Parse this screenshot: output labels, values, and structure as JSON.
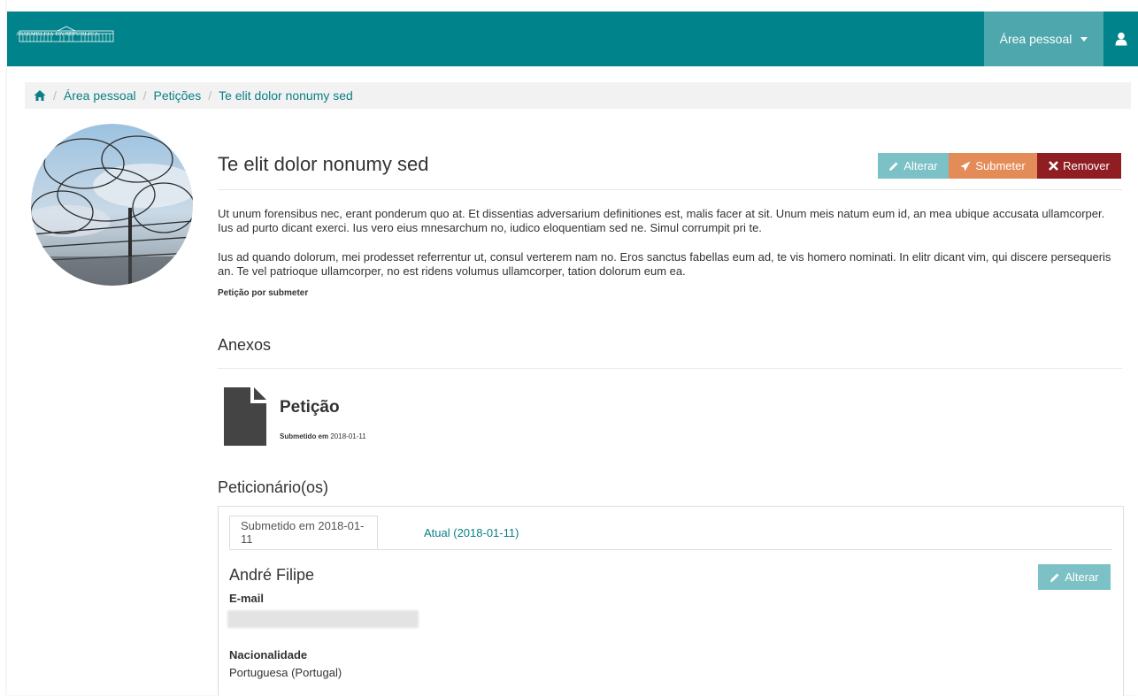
{
  "header": {
    "logo_text": "ASSEMBLEIA DA REPÚBLICA",
    "user_menu_label": "Área pessoal"
  },
  "breadcrumb": {
    "items": [
      "Área pessoal",
      "Petições",
      "Te elit dolor nonumy sed"
    ]
  },
  "petition": {
    "title": "Te elit dolor nonumy sed",
    "actions": {
      "edit_label": "Alterar",
      "submit_label": "Submeter",
      "remove_label": "Remover"
    },
    "paragraph_1": "Ut unum forensibus nec, erant ponderum quo at. Et dissentias adversarium definitiones est, malis facer at sit. Unum meis natum eum id, an mea ubique accusata ullamcorper. Ius ad purto dicant exerci. Ius vero eius mnesarchum no, iudico eloquentiam sed ne. Simul corrumpit pri te.",
    "paragraph_2": "Ius ad quando dolorum, mei prodesset referrentur ut, consul verterem nam no. Eros sanctus fabellas eum ad, te vis homero nominati. In elitr dicant vim, qui discere persequeris an. Te vel patrioque ullamcorper, no est ridens volumus ullamcorper, tation dolorum eum ea.",
    "status": "Petição por submeter"
  },
  "attachments": {
    "heading": "Anexos",
    "file_title": "Petição",
    "submitted_label": "Submetido em",
    "submitted_date": "2018-01-11"
  },
  "petitioners": {
    "heading": "Peticionário(os)",
    "tabs": [
      "Submetido em 2018-01-11",
      "Atual (2018-01-11)"
    ],
    "name": "André Filipe",
    "edit_label": "Alterar",
    "email_label": "E-mail",
    "nationality_label": "Nacionalidade",
    "nationality_value": "Portuguesa (Portugal)"
  },
  "colors": {
    "brand": "#00838a",
    "edit": "#7cc1c5",
    "submit": "#e48c58",
    "remove": "#8f1d22"
  }
}
